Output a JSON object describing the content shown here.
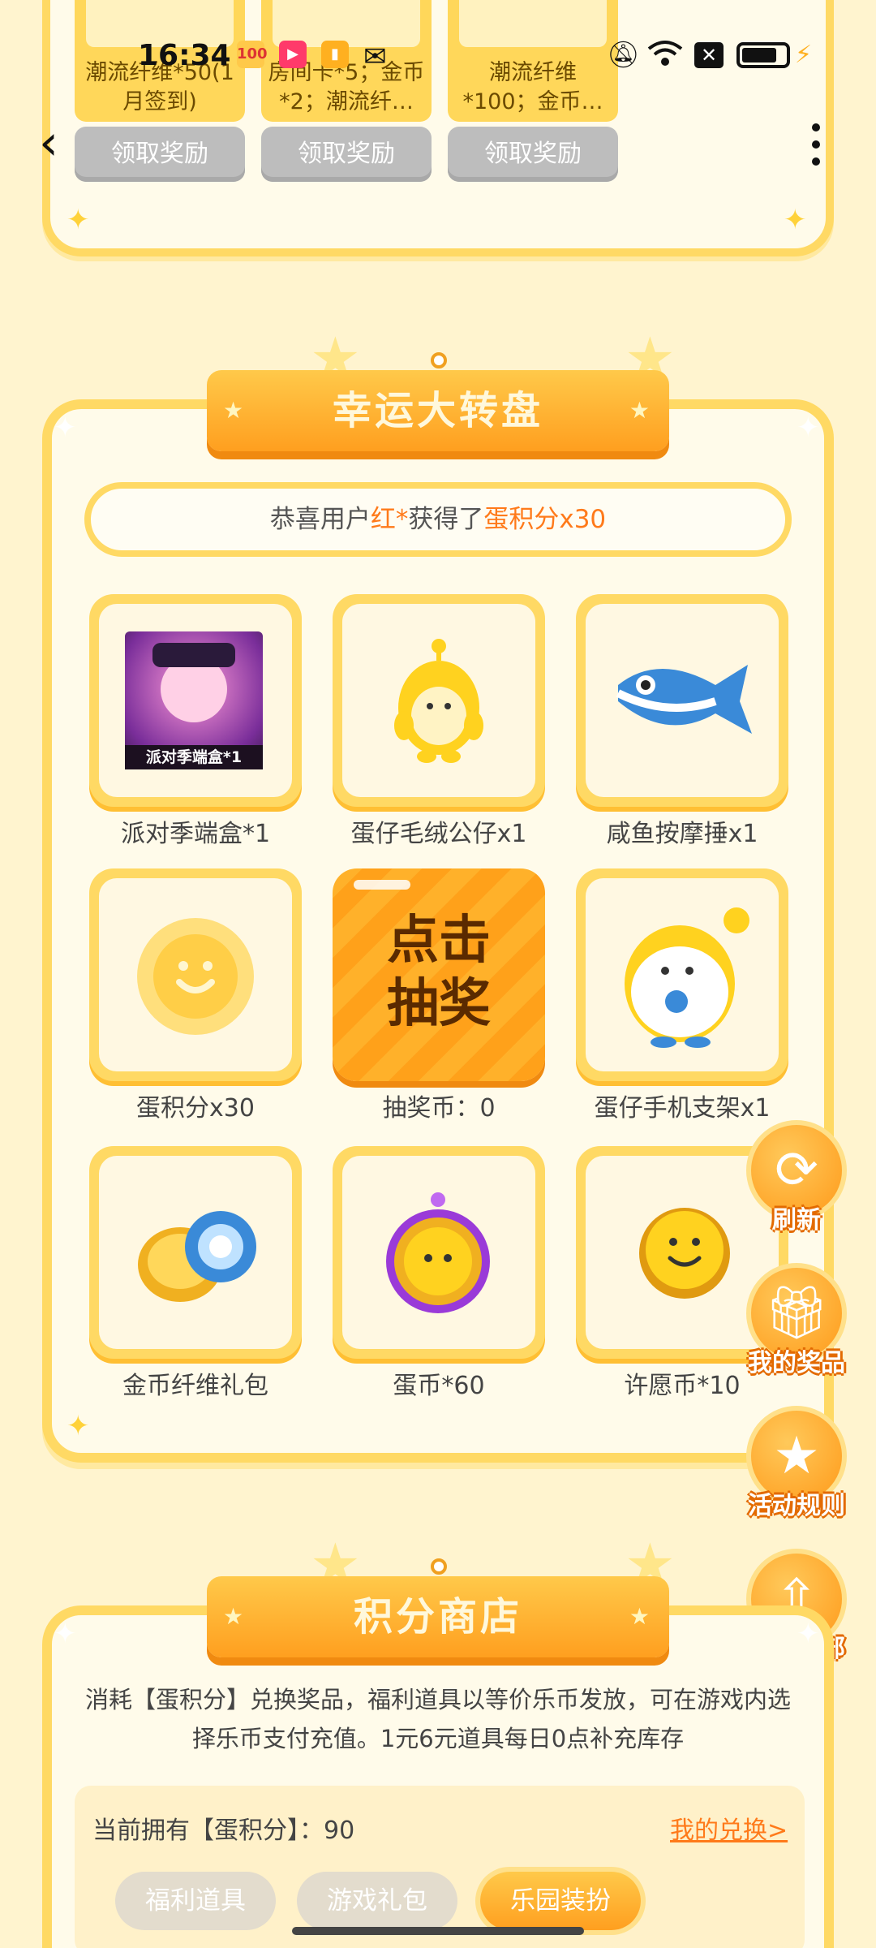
{
  "status_bar": {
    "time": "16:34",
    "app_icons": [
      "100",
      "▶",
      "▮",
      "wechat"
    ]
  },
  "top_rewards": [
    {
      "label": "潮流纤维*50(1月签到)",
      "button": "领取奖励"
    },
    {
      "label": "房间卡*5；金币*2；潮流纤…",
      "button": "领取奖励"
    },
    {
      "label": "潮流纤维*100；金币…",
      "button": "领取奖励"
    }
  ],
  "wheel": {
    "title": "幸运大转盘",
    "winner_prefix": "恭喜用户",
    "winner_user": "红*",
    "winner_mid": "获得了",
    "winner_prize": "蛋积分x30",
    "prizes": [
      {
        "label": "派对季端盒*1",
        "image_caption": "派对季端盒*1"
      },
      {
        "label": "蛋仔毛绒公仔x1"
      },
      {
        "label": "咸鱼按摩捶x1"
      },
      {
        "label": "蛋积分x30"
      },
      {
        "label": "抽奖币：0",
        "draw_text_1": "点击",
        "draw_text_2": "抽奖"
      },
      {
        "label": "蛋仔手机支架x1"
      },
      {
        "label": "金币纤维礼包"
      },
      {
        "label": "蛋币*60"
      },
      {
        "label": "许愿币*10"
      }
    ]
  },
  "side_buttons": {
    "refresh": "刷新",
    "my_prizes": "我的奖品",
    "rules": "活动规则",
    "back_top": "返回顶部"
  },
  "shop": {
    "title": "积分商店",
    "description": "消耗【蛋积分】兑换奖品，福利道具以等价乐币发放，可在游戏内选择乐币支付充值。1元6元道具每日0点补充库存",
    "points_text": "当前拥有【蛋积分】：90",
    "my_exchange": "我的兑换>",
    "tabs": [
      "福利道具",
      "游戏礼包",
      "乐园装扮"
    ]
  },
  "colors": {
    "accent": "#ff9f1f",
    "highlight": "#ff7a1a",
    "panel_border": "#ffd964",
    "disabled_button": "#bdbdbd"
  }
}
